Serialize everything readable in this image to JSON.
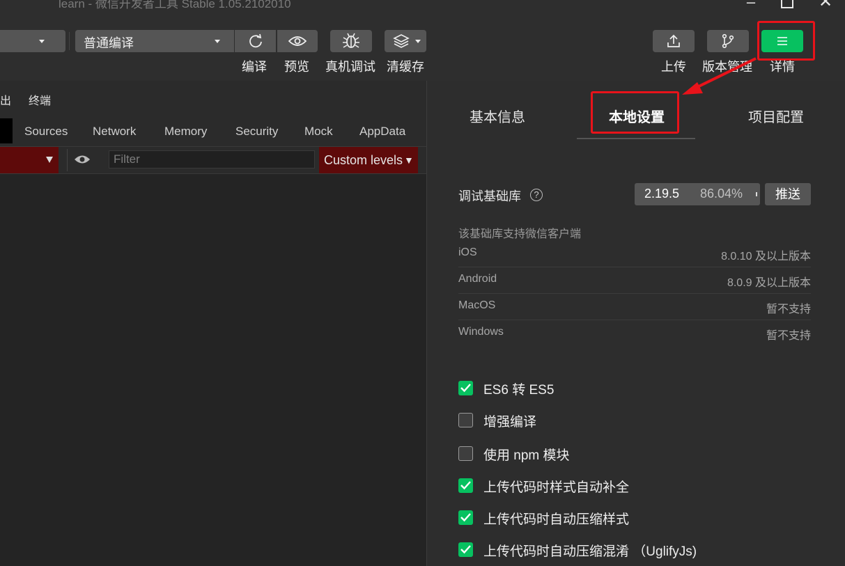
{
  "window": {
    "title": "learn - 微信开发者工具 Stable 1.05.2102010"
  },
  "toolbar": {
    "compile_mode": "普通编译",
    "buttons": [
      {
        "label": "编译",
        "icon": "refresh-icon"
      },
      {
        "label": "预览",
        "icon": "eye-icon"
      },
      {
        "label": "真机调试",
        "icon": "bug-icon"
      },
      {
        "label": "清缓存",
        "icon": "layers-icon"
      }
    ],
    "right_buttons": [
      {
        "label": "上传",
        "icon": "upload-icon"
      },
      {
        "label": "版本管理",
        "icon": "branch-icon"
      },
      {
        "label": "详情",
        "icon": "menu-icon"
      }
    ]
  },
  "devtools": {
    "header_tabs": [
      "出",
      "终端"
    ],
    "tabs": [
      "Sources",
      "Network",
      "Memory",
      "Security",
      "Mock",
      "AppData"
    ],
    "filter_placeholder": "Filter",
    "levels_label": "Custom levels"
  },
  "panel": {
    "tabs": [
      {
        "label": "基本信息",
        "active": false
      },
      {
        "label": "本地设置",
        "active": true
      },
      {
        "label": "项目配置",
        "active": false
      }
    ],
    "lib": {
      "label": "调试基础库",
      "help": "?",
      "version": "2.19.5",
      "percent": "86.04%",
      "push_label": "推送"
    },
    "support_note": "该基础库支持微信客户端",
    "support": [
      {
        "platform": "iOS",
        "value": "8.0.10 及以上版本"
      },
      {
        "platform": "Android",
        "value": "8.0.9 及以上版本"
      },
      {
        "platform": "MacOS",
        "value": "暂不支持"
      },
      {
        "platform": "Windows",
        "value": "暂不支持"
      }
    ],
    "options": [
      {
        "label": "ES6 转 ES5",
        "checked": true
      },
      {
        "label": "增强编译",
        "checked": false
      },
      {
        "label": "使用 npm 模块",
        "checked": false
      },
      {
        "label": "上传代码时样式自动补全",
        "checked": true
      },
      {
        "label": "上传代码时自动压缩样式",
        "checked": true
      },
      {
        "label": "上传代码时自动压缩混淆 （UglifyJs)",
        "checked": true
      }
    ]
  },
  "colors": {
    "accent": "#07c160",
    "highlight": "#e8131a"
  }
}
